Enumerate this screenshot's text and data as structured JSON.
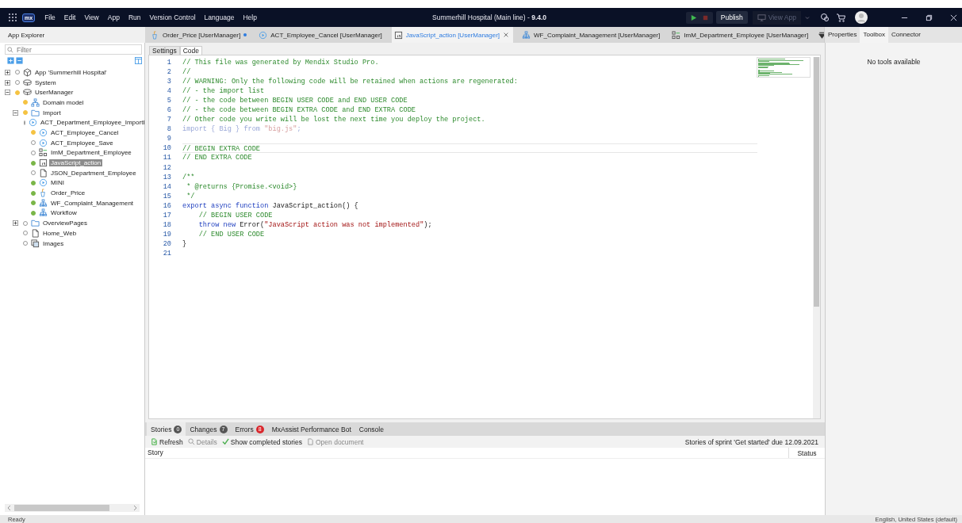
{
  "title_bar": {
    "logo": "mx",
    "menu": [
      "File",
      "Edit",
      "View",
      "App",
      "Run",
      "Version Control",
      "Language",
      "Help"
    ],
    "title": "Summerhill Hospital (Main line)  -  **9.4.0**",
    "publish": "Publish",
    "view_app": {
      "label": "View App",
      "disabled": true
    }
  },
  "app_explorer": {
    "title": "App Explorer",
    "filter": {
      "placeholder": "Filter"
    },
    "tree": [
      {
        "label": "App 'Summerhill Hospital'",
        "kind": "app",
        "expanded": false,
        "selected": false
      },
      {
        "label": "System",
        "kind": "module",
        "expanded": false,
        "selected": false
      },
      {
        "label": "UserManager",
        "kind": "module",
        "color": "#f5c342",
        "expanded": true,
        "selected": false,
        "children": [
          {
            "label": "Domain model",
            "kind": "domain",
            "color": "#f5c342",
            "selected": false
          },
          {
            "label": "Import",
            "kind": "folder",
            "color": "#f5c342",
            "expanded": true,
            "selected": false,
            "children": [
              {
                "label": "ACT_Department_Employee_ImportI",
                "kind": "microflow",
                "selected": false
              },
              {
                "label": "ACT_Employee_Cancel",
                "kind": "microflow",
                "color": "#f5c342",
                "selected": false
              },
              {
                "label": "ACT_Employee_Save",
                "kind": "microflow",
                "selected": false
              },
              {
                "label": "ImM_Department_Employee",
                "kind": "mapping",
                "selected": false
              },
              {
                "label": "JavaScript_action",
                "kind": "js",
                "color": "#7ab648",
                "selected": true
              },
              {
                "label": "JSON_Department_Employee",
                "kind": "page",
                "selected": false
              },
              {
                "label": "MINI",
                "kind": "microflow",
                "color": "#7ab648",
                "selected": false
              },
              {
                "label": "Order_Price",
                "kind": "rule",
                "color": "#7ab648",
                "selected": false
              },
              {
                "label": "WF_Complaint_Management",
                "kind": "workflow",
                "color": "#7ab648",
                "selected": false
              },
              {
                "label": "Workflow",
                "kind": "workflow",
                "color": "#7ab648",
                "selected": false
              }
            ]
          },
          {
            "label": "OverviewPages",
            "kind": "folder",
            "expanded": false,
            "selected": false
          },
          {
            "label": "Home_Web",
            "kind": "page",
            "selected": false
          },
          {
            "label": "Images",
            "kind": "images",
            "selected": false
          }
        ]
      }
    ]
  },
  "doc_tabs": [
    {
      "label": "Order_Price [UserManager]",
      "kind": "rule",
      "selected": false,
      "unsaved": true
    },
    {
      "label": "ACT_Employee_Cancel [UserManager]",
      "kind": "microflow",
      "selected": false,
      "unsaved": false
    },
    {
      "label": "JavaScript_action [UserManager]",
      "kind": "js",
      "selected": true,
      "unsaved": false
    },
    {
      "label": "WF_Complaint_Management [UserManager]",
      "kind": "workflow",
      "selected": false,
      "unsaved": false
    },
    {
      "label": "ImM_Department_Employee [UserManager]",
      "kind": "mapping",
      "selected": false,
      "unsaved": false
    }
  ],
  "editor_tabs": [
    {
      "label": "Settings",
      "selected": false
    },
    {
      "label": "Code",
      "selected": true
    }
  ],
  "code": [
    {
      "n": "1",
      "tokens": [
        {
          "kind": "comment",
          "text": "// This file was generated by Mendix Studio Pro."
        }
      ]
    },
    {
      "n": "2",
      "tokens": [
        {
          "kind": "comment",
          "text": "//"
        }
      ]
    },
    {
      "n": "3",
      "tokens": [
        {
          "kind": "comment",
          "text": "// WARNING: Only the following code will be retained when actions are regenerated:"
        }
      ]
    },
    {
      "n": "4",
      "tokens": [
        {
          "kind": "comment",
          "text": "// - the import list"
        }
      ]
    },
    {
      "n": "5",
      "tokens": [
        {
          "kind": "comment",
          "text": "// - the code between BEGIN USER CODE and END USER CODE"
        }
      ]
    },
    {
      "n": "6",
      "tokens": [
        {
          "kind": "comment",
          "text": "// - the code between BEGIN EXTRA CODE and END EXTRA CODE"
        }
      ]
    },
    {
      "n": "7",
      "tokens": [
        {
          "kind": "comment",
          "text": "// Other code you write will be lost the next time you deploy the project."
        }
      ]
    },
    {
      "n": "8",
      "tokens": [
        {
          "kind": "dim-keyword",
          "text": "import"
        },
        {
          "kind": "dim",
          "text": " { Big } "
        },
        {
          "kind": "dim-keyword",
          "text": "from"
        },
        {
          "kind": "dim-string",
          "text": " \"big.js\""
        },
        {
          "kind": "dim",
          "text": ";"
        }
      ]
    },
    {
      "n": "9"
    },
    {
      "n": "10",
      "current": true,
      "tokens": [
        {
          "kind": "comment",
          "text": "// BEGIN EXTRA CODE"
        }
      ]
    },
    {
      "n": "11",
      "tokens": [
        {
          "kind": "comment",
          "text": "// END EXTRA CODE"
        }
      ]
    },
    {
      "n": "12"
    },
    {
      "n": "13",
      "tokens": [
        {
          "kind": "comment",
          "text": "/**"
        }
      ]
    },
    {
      "n": "14",
      "tokens": [
        {
          "kind": "comment",
          "text": " * @returns {Promise.<void>}"
        }
      ]
    },
    {
      "n": "15",
      "tokens": [
        {
          "kind": "comment",
          "text": " */"
        }
      ]
    },
    {
      "n": "16",
      "tokens": [
        {
          "kind": "keyword",
          "text": "export async function"
        },
        {
          "kind": "plain",
          "text": " JavaScript_action() {"
        }
      ]
    },
    {
      "n": "17",
      "tokens": [
        {
          "kind": "comment",
          "text": "    // BEGIN USER CODE"
        }
      ]
    },
    {
      "n": "18",
      "tokens": [
        {
          "kind": "keyword",
          "text": "    throw new"
        },
        {
          "kind": "plain",
          "text": " Error("
        },
        {
          "kind": "string",
          "text": "\"JavaScript action was not implemented\""
        },
        {
          "kind": "plain",
          "text": ");"
        }
      ]
    },
    {
      "n": "19",
      "tokens": [
        {
          "kind": "comment",
          "text": "    // END USER CODE"
        }
      ]
    },
    {
      "n": "20",
      "tokens": [
        {
          "kind": "plain",
          "text": "}"
        }
      ]
    },
    {
      "n": "21"
    }
  ],
  "bottom_tabs": [
    {
      "label": "Stories",
      "badge": "0",
      "color": "#555555",
      "selected": true
    },
    {
      "label": "Changes",
      "badge": "7",
      "color": "#555555",
      "selected": false
    },
    {
      "label": "Errors",
      "badge": "8",
      "color": "#d9262c",
      "selected": false
    },
    {
      "label": "MxAssist Performance Bot",
      "selected": false
    },
    {
      "label": "Console",
      "selected": false
    }
  ],
  "stories_toolbar": [
    {
      "label": "Refresh",
      "kind": "refresh",
      "disabled": false
    },
    {
      "label": "Details",
      "kind": "details",
      "disabled": true
    },
    {
      "label": "Show completed stories",
      "kind": "check",
      "disabled": false
    },
    {
      "label": "Open document",
      "kind": "document",
      "disabled": true
    }
  ],
  "sprint": "Stories of sprint 'Get started' due 12.09.2021",
  "stories_columns": [
    "Story",
    "Status"
  ],
  "right_tabs": [
    {
      "label": "Properties",
      "selected": false
    },
    {
      "label": "Toolbox",
      "selected": true
    },
    {
      "label": "Connector",
      "selected": false
    }
  ],
  "toolbox_message": "No tools available",
  "status_bar": {
    "left": "Ready",
    "right": "English, United States (default)"
  }
}
